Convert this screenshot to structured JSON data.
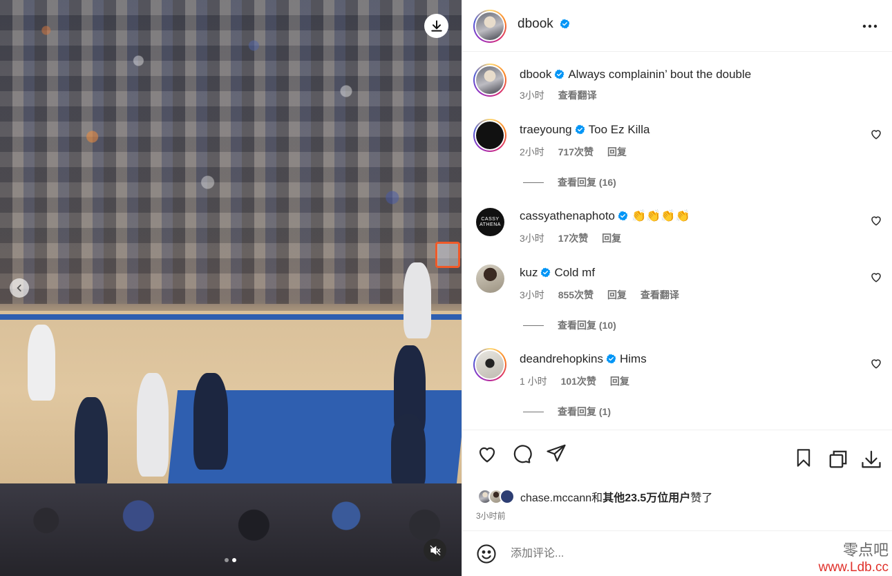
{
  "post": {
    "username": "dbook",
    "caption": "Always complainin’ bout the double",
    "caption_time": "3小时",
    "caption_translate": "查看翻译"
  },
  "comments": [
    {
      "username": "traeyoung",
      "text": "Too Ez Killa",
      "time": "2小时",
      "likes": "717次赞",
      "reply": "回复",
      "view_replies": "查看回复 (16)"
    },
    {
      "username": "cassyathenaphoto",
      "avatar_text": "CASSY ATHENA",
      "text": "👏👏👏👏",
      "time": "3小时",
      "likes": "17次赞",
      "reply": "回复"
    },
    {
      "username": "kuz",
      "text": "Cold mf",
      "time": "3小时",
      "likes": "855次赞",
      "reply": "回复",
      "translate": "查看翻译",
      "view_replies": "查看回复 (10)"
    },
    {
      "username": "deandrehopkins",
      "text": "Hims",
      "time": "1 小时",
      "likes": "101次赞",
      "reply": "回复",
      "view_replies": "查看回复 (1)"
    }
  ],
  "likes_summary": {
    "liker": "chase.mccann",
    "conj": "和",
    "others": "其他23.5万位用户",
    "suffix": "赞了"
  },
  "post_time": "3小时前",
  "add_comment": {
    "placeholder": "添加评论..."
  },
  "watermark": {
    "line1": "零点吧",
    "line2": "www.Ldb.cc"
  },
  "colors": {
    "verified": "#0095f6",
    "text": "#262626",
    "muted": "#737373"
  },
  "icons": [
    "download-icon",
    "chevron-left-icon",
    "mute-icon",
    "more-icon",
    "verified-icon",
    "heart-icon",
    "comment-icon",
    "share-icon",
    "bookmark-icon",
    "multi-post-icon",
    "download-icon",
    "emoji-icon"
  ]
}
